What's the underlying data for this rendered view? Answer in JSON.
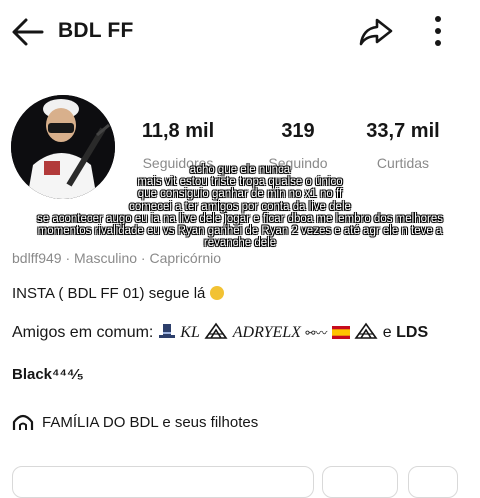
{
  "header": {
    "back_icon": "arrow-left-icon",
    "username": "BDL FF",
    "share_icon": "share-icon",
    "more_icon": "more-vertical-icon"
  },
  "stats": [
    {
      "value": "11,8 mil",
      "label": "Seguidores"
    },
    {
      "value": "319",
      "label": "Seguindo"
    },
    {
      "value": "33,7 mil",
      "label": "Curtidas"
    }
  ],
  "profile": {
    "meta": "bdlff949 · Masculino · Capricórnio",
    "bio": "INSTA ( BDL FF 01) segue lá",
    "mutual_prefix": "Amigos em comum:",
    "mutual_name_1": "KL",
    "mutual_name_2": "ADRYELX",
    "mutual_and": "e",
    "mutual_last": "LDS",
    "badge": "Black⁴⁴⁴⁄₅",
    "family": "FAMÍLIA DO BDL e seus filhotes"
  },
  "caption_lines": [
    "acho que ele nunca",
    "mais vit estou triste tropa qualse o único",
    "que consiguio ganhar de min no x1 no ff",
    "comecei a ter amigos por conta da live dele",
    "se acontecer augo eu ia na live dele jogar e ficar dboa me lembro dos melhores",
    "momentos rivalidade eu vs Ryan ganhei de Ryan 2 vezes e até agr ele n teve a",
    "revanche dele"
  ],
  "colors": {
    "text": "#161616",
    "muted": "#8a8a8a",
    "emoji": "#f2c233"
  }
}
